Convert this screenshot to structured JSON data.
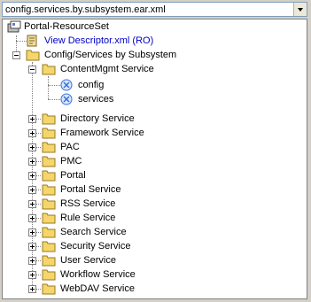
{
  "combo": {
    "value": "config.services.by.subsystem.ear.xml"
  },
  "tree": {
    "root": "Portal-ResourceSet",
    "descriptor": "View Descriptor.xml (RO)",
    "group": "Config/Services by Subsystem",
    "content_mgmt": "ContentMgmt Service",
    "leaf_config": "config",
    "leaf_services": "services",
    "services": [
      "Directory Service",
      "Framework Service",
      "PAC",
      "PMC",
      "Portal",
      "Portal Service",
      "RSS Service",
      "Rule Service",
      "Search Service",
      "Security Service",
      "User Service",
      "Workflow Service",
      "WebDAV Service"
    ]
  },
  "colors": {
    "folder": "#f5d66a",
    "link": "#0000cc",
    "leaf_icon": "#3a6fd8"
  }
}
